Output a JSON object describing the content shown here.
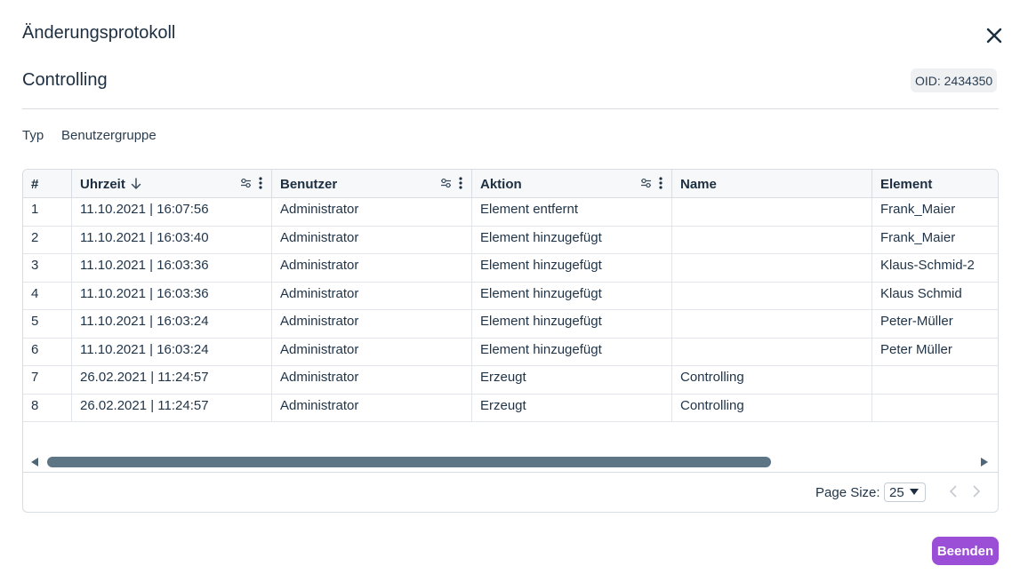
{
  "dialog": {
    "title": "Änderungsprotokoll",
    "record_title": "Controlling",
    "oid": "OID: 2434350"
  },
  "meta": {
    "type_label": "Typ",
    "type_value": "Benutzergruppe"
  },
  "table": {
    "columns": [
      {
        "label": "#"
      },
      {
        "label": "Uhrzeit"
      },
      {
        "label": "Benutzer"
      },
      {
        "label": "Aktion"
      },
      {
        "label": "Name"
      },
      {
        "label": "Element"
      }
    ],
    "rows": [
      {
        "num": "1",
        "time": "11.10.2021 | 16:07:56",
        "user": "Administrator",
        "action": "Element entfernt",
        "name": "",
        "element": "Frank_Maier"
      },
      {
        "num": "2",
        "time": "11.10.2021 | 16:03:40",
        "user": "Administrator",
        "action": "Element hinzugefügt",
        "name": "",
        "element": "Frank_Maier"
      },
      {
        "num": "3",
        "time": "11.10.2021 | 16:03:36",
        "user": "Administrator",
        "action": "Element hinzugefügt",
        "name": "",
        "element": "Klaus-Schmid-2"
      },
      {
        "num": "4",
        "time": "11.10.2021 | 16:03:36",
        "user": "Administrator",
        "action": "Element hinzugefügt",
        "name": "",
        "element": "Klaus Schmid"
      },
      {
        "num": "5",
        "time": "11.10.2021 | 16:03:24",
        "user": "Administrator",
        "action": "Element hinzugefügt",
        "name": "",
        "element": "Peter-Müller"
      },
      {
        "num": "6",
        "time": "11.10.2021 | 16:03:24",
        "user": "Administrator",
        "action": "Element hinzugefügt",
        "name": "",
        "element": "Peter Müller"
      },
      {
        "num": "7",
        "time": "26.02.2021 | 11:24:57",
        "user": "Administrator",
        "action": "Erzeugt",
        "name": "Controlling",
        "element": ""
      },
      {
        "num": "8",
        "time": "26.02.2021 | 11:24:57",
        "user": "Administrator",
        "action": "Erzeugt",
        "name": "Controlling",
        "element": ""
      }
    ]
  },
  "pagination": {
    "page_size_label": "Page Size:",
    "page_size_value": "25"
  },
  "actions": {
    "finish_label": "Beenden"
  },
  "colors": {
    "primary": "#9b4fd6",
    "text": "#1f3347",
    "scrollbar_thumb": "#5d7584"
  }
}
